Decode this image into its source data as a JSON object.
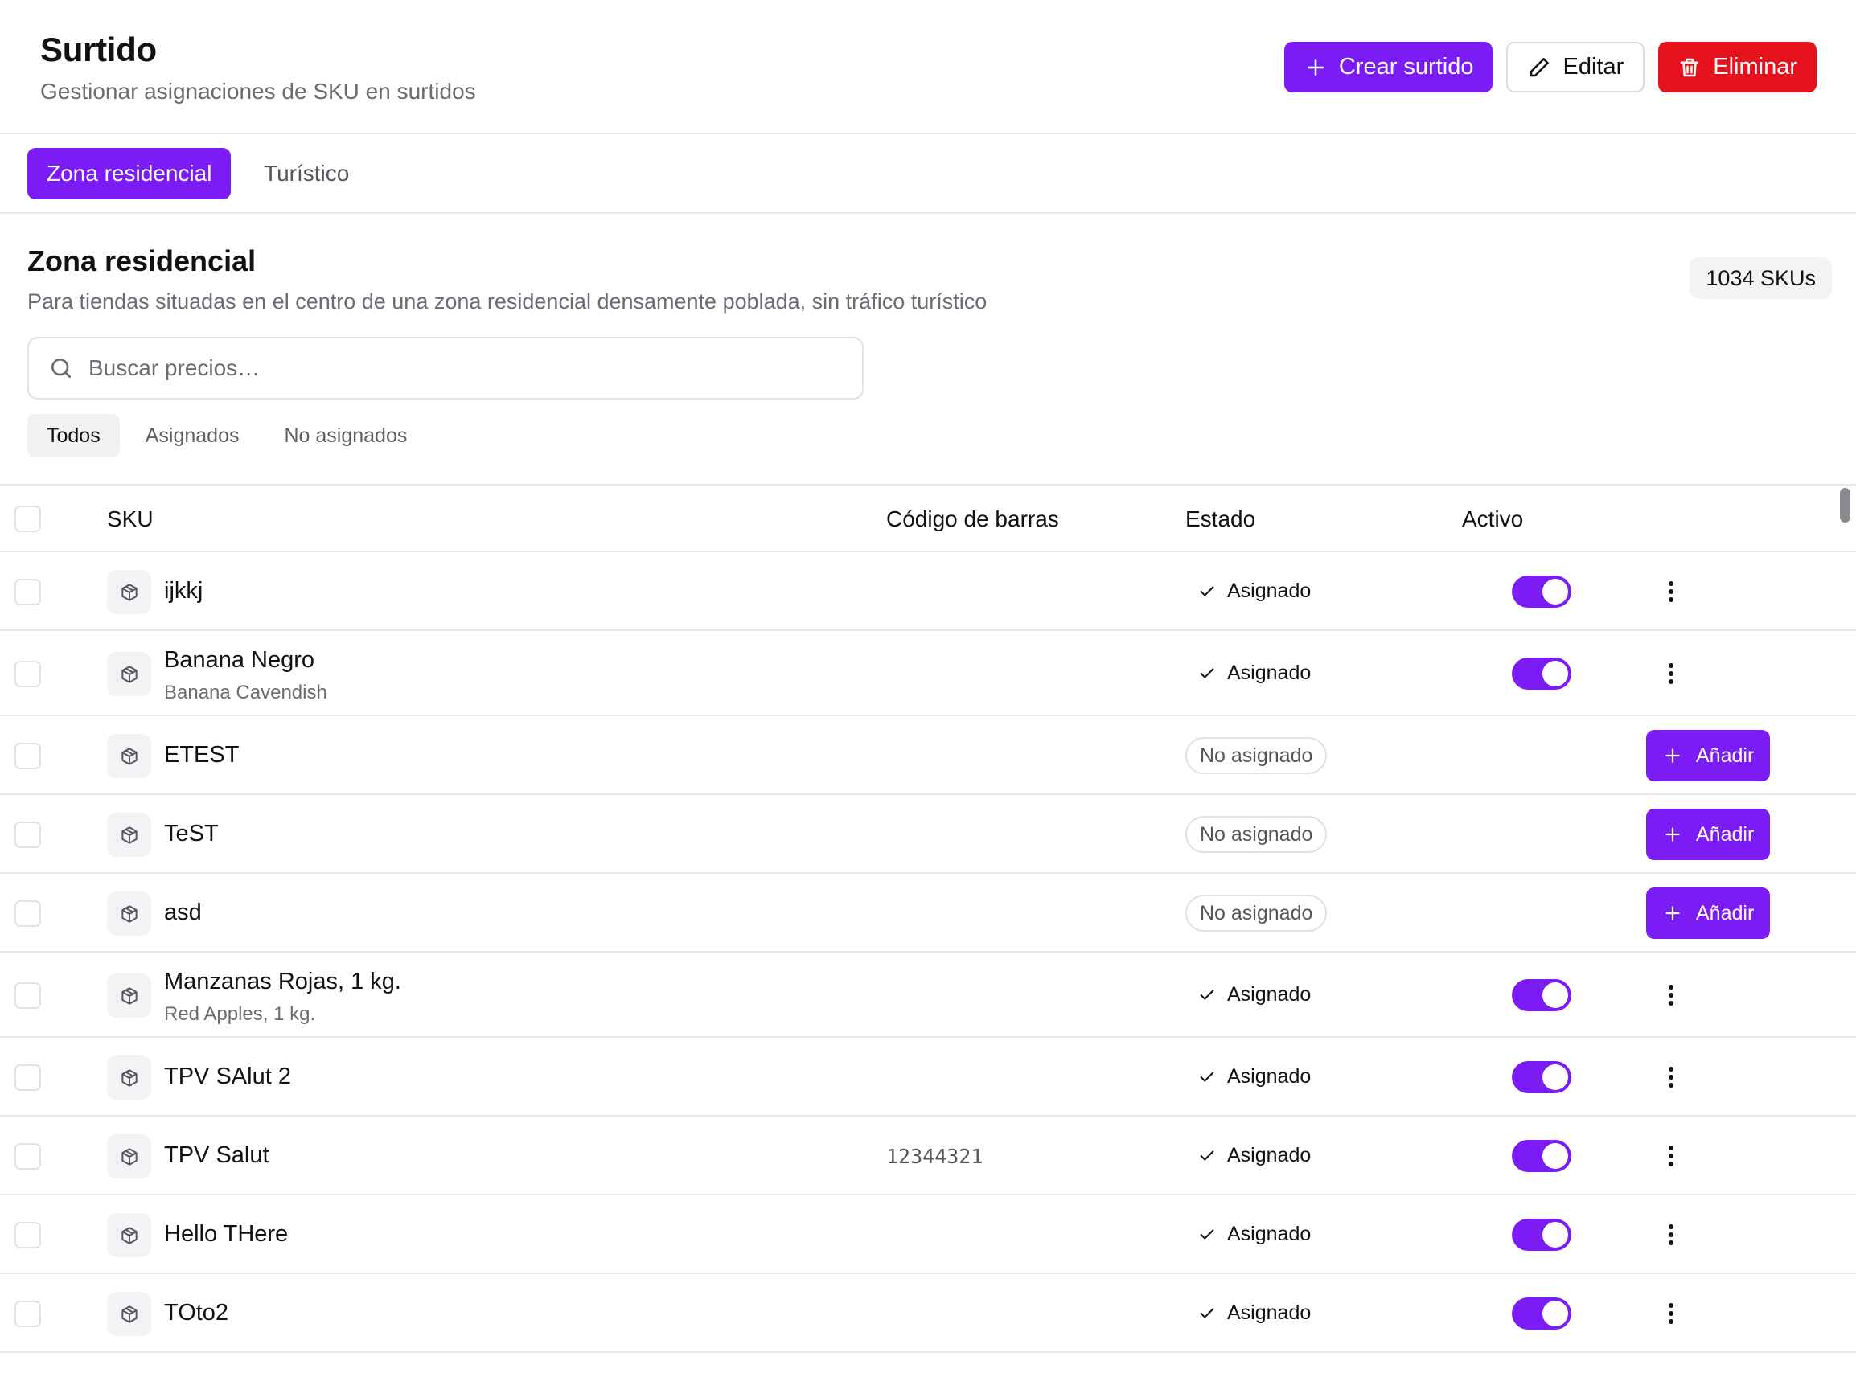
{
  "header": {
    "title": "Surtido",
    "subtitle": "Gestionar asignaciones de SKU en surtidos",
    "create_label": "Crear surtido",
    "edit_label": "Editar",
    "delete_label": "Eliminar"
  },
  "tabs": [
    {
      "label": "Zona residencial",
      "active": true
    },
    {
      "label": "Turístico",
      "active": false
    }
  ],
  "section": {
    "title": "Zona residencial",
    "description": "Para tiendas situadas en el centro de una zona residencial densamente poblada, sin tráfico turístico",
    "count": "1034 SKUs"
  },
  "search": {
    "placeholder": "Buscar precios…",
    "value": ""
  },
  "filters": [
    {
      "label": "Todos",
      "active": true
    },
    {
      "label": "Asignados",
      "active": false
    },
    {
      "label": "No asignados",
      "active": false
    }
  ],
  "table": {
    "columns": {
      "sku": "SKU",
      "barcode": "Código de barras",
      "status": "Estado",
      "active": "Activo"
    },
    "add_label": "Añadir",
    "rows": [
      {
        "name": "ijkkj",
        "sub": "",
        "barcode": "",
        "status": "Asignado",
        "assigned": true
      },
      {
        "name": "Banana Negro",
        "sub": "Banana Cavendish",
        "barcode": "",
        "status": "Asignado",
        "assigned": true
      },
      {
        "name": "ETEST",
        "sub": "",
        "barcode": "",
        "status": "No asignado",
        "assigned": false
      },
      {
        "name": "TeST",
        "sub": "",
        "barcode": "",
        "status": "No asignado",
        "assigned": false
      },
      {
        "name": "asd",
        "sub": "",
        "barcode": "",
        "status": "No asignado",
        "assigned": false
      },
      {
        "name": "Manzanas Rojas, 1 kg.",
        "sub": "Red Apples, 1 kg.",
        "barcode": "",
        "status": "Asignado",
        "assigned": true
      },
      {
        "name": "TPV SAlut 2",
        "sub": "",
        "barcode": "",
        "status": "Asignado",
        "assigned": true
      },
      {
        "name": "TPV Salut",
        "sub": "",
        "barcode": "12344321",
        "status": "Asignado",
        "assigned": true
      },
      {
        "name": "Hello THere",
        "sub": "",
        "barcode": "",
        "status": "Asignado",
        "assigned": true
      },
      {
        "name": "TOto2",
        "sub": "",
        "barcode": "",
        "status": "Asignado",
        "assigned": true
      }
    ]
  },
  "colors": {
    "accent": "#7c1cf5",
    "danger": "#e5121d"
  },
  "icons": {
    "create": "plus-icon",
    "edit": "pencil-icon",
    "delete": "trash-icon",
    "search": "search-icon",
    "sku": "package-icon",
    "status": "check-icon",
    "menu": "kebab-icon"
  }
}
